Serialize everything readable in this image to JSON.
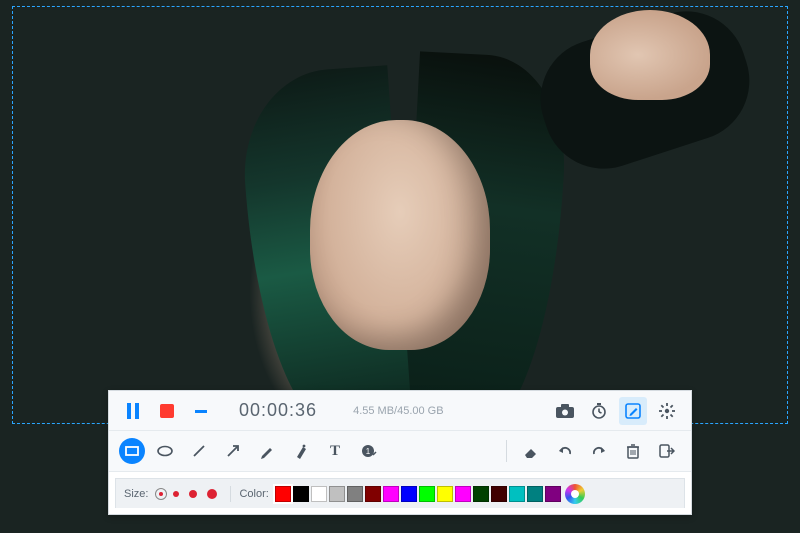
{
  "recorder": {
    "timer": "00:00:36",
    "file_size": "4.55 MB/45.00 GB",
    "colors": {
      "accent": "#0a84ff",
      "record": "#ff3b30"
    }
  },
  "annotation": {
    "tools": [
      {
        "name": "rectangle",
        "active": true
      },
      {
        "name": "ellipse"
      },
      {
        "name": "line"
      },
      {
        "name": "arrow"
      },
      {
        "name": "pencil"
      },
      {
        "name": "marker"
      },
      {
        "name": "text"
      },
      {
        "name": "counter"
      }
    ],
    "actions": [
      {
        "name": "eraser"
      },
      {
        "name": "undo"
      },
      {
        "name": "redo"
      },
      {
        "name": "trash"
      },
      {
        "name": "exit"
      }
    ]
  },
  "size_row": {
    "label": "Size:",
    "sizes": [
      4,
      6,
      8,
      10
    ],
    "selected_index": 0
  },
  "color_row": {
    "label": "Color:",
    "selected_index": 0,
    "swatches": [
      "#ff0000",
      "#000000",
      "#ffffff",
      "#c0c0c0",
      "#808080",
      "#800000",
      "#ff00ff",
      "#0000ff",
      "#00ff00",
      "#ffff00",
      "#ff00ff",
      "#004000",
      "#400000",
      "#00c0c0",
      "#008080",
      "#800080"
    ]
  }
}
